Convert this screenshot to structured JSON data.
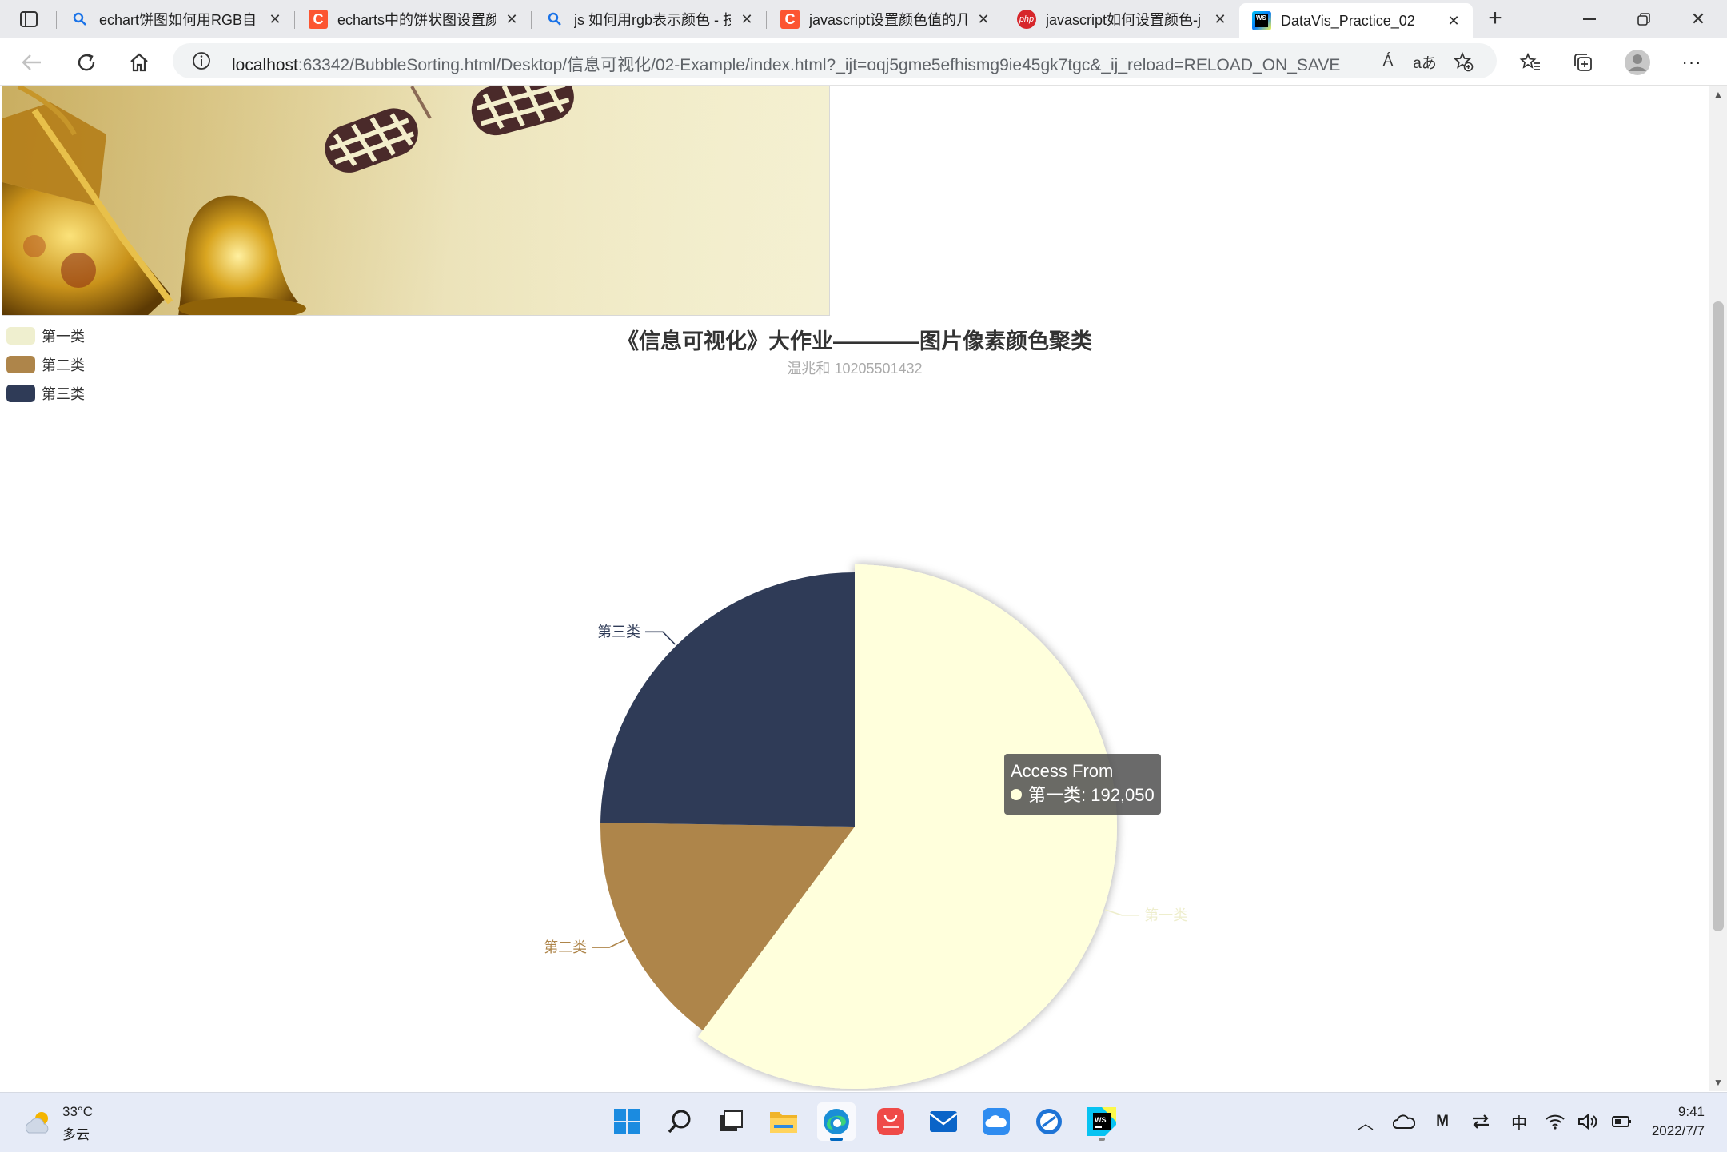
{
  "browser": {
    "tabs": [
      {
        "title": "echart饼图如何用RGB自",
        "favicon": "search-icon",
        "active": false
      },
      {
        "title": "echarts中的饼状图设置颜",
        "favicon": "csdn-icon",
        "active": false
      },
      {
        "title": "js 如何用rgb表示颜色 - 技",
        "favicon": "search-icon",
        "active": false
      },
      {
        "title": "javascript设置颜色值的几",
        "favicon": "csdn-icon",
        "active": false
      },
      {
        "title": "javascript如何设置颜色-j",
        "favicon": "php-icon",
        "active": false
      },
      {
        "title": "DataVis_Practice_02",
        "favicon": "webstorm-icon",
        "active": true
      }
    ],
    "url_host": "localhost",
    "url_rest": ":63342/BubbleSorting.html/Desktop/信息可视化/02-Example/index.html?_ijt=oqj5gme5efhismg9ie45gk7tgc&_ij_reload=RELOAD_ON_SAVE",
    "read_aloud": "Á",
    "translate": "aあ"
  },
  "chart_data": {
    "type": "pie",
    "title": "《信息可视化》大作业————图片像素颜色聚类",
    "subtitle": "温兆和 10205501432",
    "legend_position": "top-left",
    "series_name": "Access From",
    "slices": [
      {
        "name": "第一类",
        "value": 192050,
        "color": "#ffffdc",
        "legend_color": "#efefcf",
        "label_color": "#eeeecd"
      },
      {
        "name": "第二类",
        "value": 48000,
        "color": "#ae854a",
        "legend_color": "#ae854a",
        "label_color": "#ae854a"
      },
      {
        "name": "第三类",
        "value": 79000,
        "color": "#2f3b57",
        "legend_color": "#2f3b57",
        "label_color": "#2f3b57"
      }
    ],
    "tooltip": {
      "title": "Access From",
      "text": "第一类: 192,050"
    }
  },
  "taskbar": {
    "temperature": "33°C",
    "condition": "多云",
    "ime": "中",
    "time": "9:41",
    "date": "2022/7/7",
    "apps": [
      "start-icon",
      "search-icon",
      "task-view-icon",
      "file-explorer-icon",
      "edge-icon",
      "huawei-appgallery-icon",
      "mail-icon",
      "cloud-icon",
      "browser-icon",
      "webstorm-icon"
    ]
  }
}
